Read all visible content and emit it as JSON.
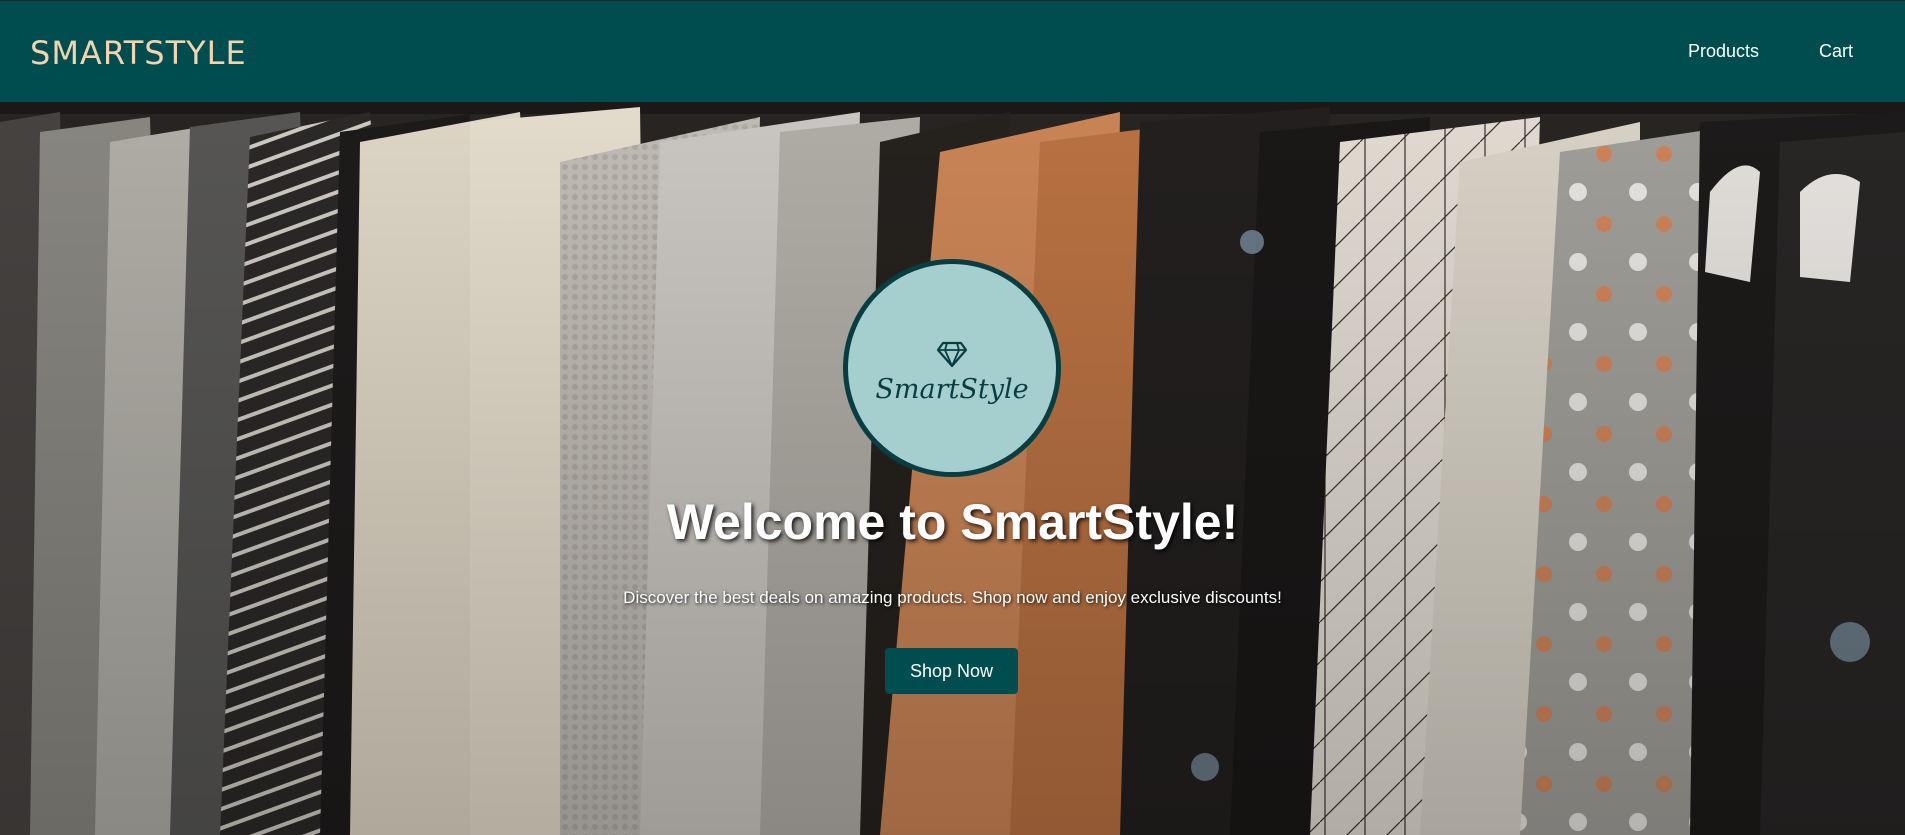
{
  "header": {
    "brand": "SMARTSTYLE",
    "nav": [
      {
        "label": "Products"
      },
      {
        "label": "Cart"
      }
    ]
  },
  "hero": {
    "logo_text": "SmartStyle",
    "logo_icon": "diamond-icon",
    "title": "Welcome to SmartStyle!",
    "subtitle": "Discover the best deals on amazing products. Shop now and enjoy exclusive discounts!",
    "cta_label": "Shop Now"
  },
  "colors": {
    "nav_background": "#004d4f",
    "brand_text": "#f4d3b0",
    "logo_fill": "#a5cfcf",
    "logo_stroke": "#083e42",
    "button_background": "#004d4f"
  }
}
